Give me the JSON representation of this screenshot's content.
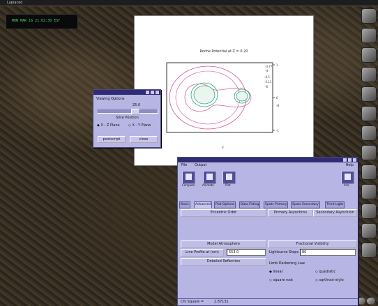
{
  "desktop": {
    "top_title": "Laplaced",
    "clock_text": "MON MAR 16 21:02:30 EST"
  },
  "plot": {
    "title": "Roche Potential at Z = 0.20",
    "contour_labels": [
      "-3.77",
      "-4",
      "-4.5",
      "-5.11",
      "-6",
      "-8"
    ],
    "axis_labels": [
      "1",
      "0",
      "-1"
    ],
    "axis_bottom": "0",
    "colors": {
      "pink": "#d1509a",
      "green": "#2fa86a",
      "teal": "#3aa3a3"
    }
  },
  "viewing_options": {
    "title": "Viewing Options",
    "slider_value": "25.0",
    "slider_fraction": 0.63,
    "slice_label": "Slice Position",
    "radio_xz": "X - Z Plane",
    "radio_xy": "X - Y Plane",
    "btn_postscript": "postscript",
    "btn_close": "close"
  },
  "main": {
    "menu_file": "File",
    "menu_output": "Output",
    "menu_help": "Help",
    "tools": [
      "Compute",
      "Animate",
      "Plot"
    ],
    "info": "Info",
    "tabs": [
      "Basic",
      "Advanced",
      "Plot Options",
      "Data Fitting",
      "Spots Primary",
      "Spots Secondary",
      "Third Light"
    ],
    "eccentric_orbit": "Eccentric Orbit",
    "primary_async": "Primary Asynchron",
    "secondary_async": "Secondary Asynchron",
    "model_atmosphere": "Model Atmosphere",
    "fractional_visibility": "Fractional Visibility",
    "line_profile_label": "Line Profile at (nm)",
    "line_profile_value": "553.0",
    "lightcurve_steps_label": "Lightcurve Steps",
    "lightcurve_steps_value": "80",
    "detailed_reflection": "Detailed Reflection",
    "limb_darkening_label": "Limb Darkening Law",
    "ld_linear": "linear",
    "ld_quadratic": "quadratic",
    "ld_square_root": "square root",
    "ld_sqrt_root_style": "sqrt/root-style",
    "chi_label": "Chi Square =",
    "chi_value": "2.87131"
  }
}
